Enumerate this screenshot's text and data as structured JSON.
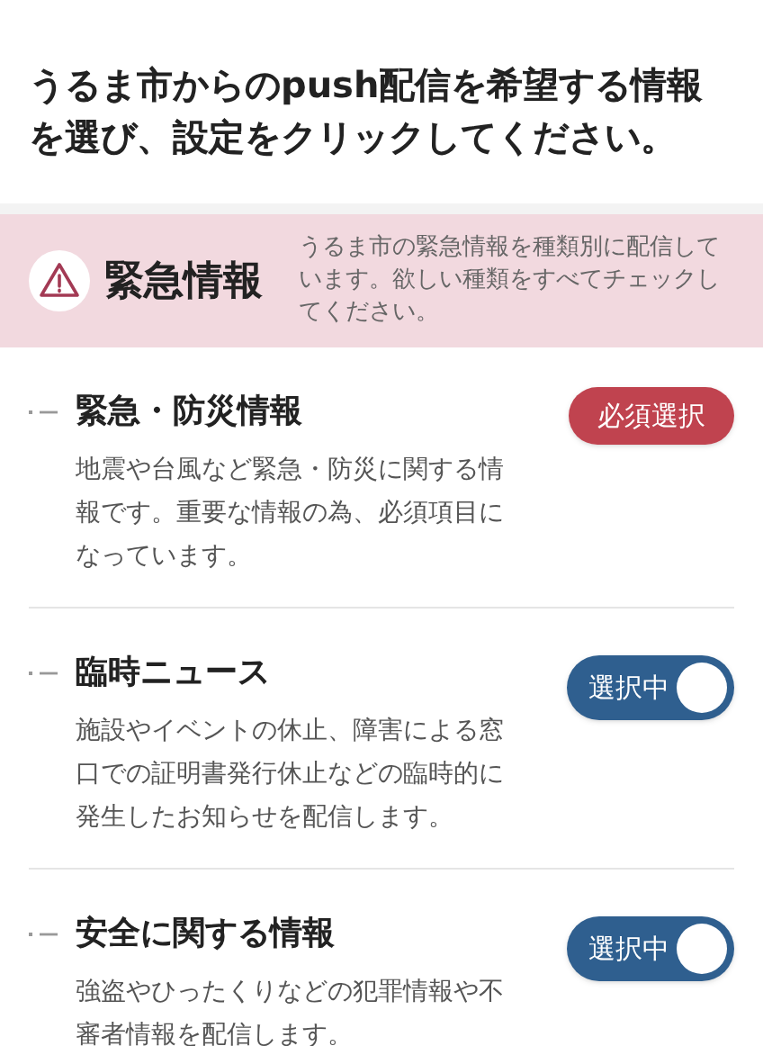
{
  "intro": "うるま市からのpush配信を希望する情報を選び、設定をクリックしてください。",
  "section": {
    "title": "緊急情報",
    "description": "うるま市の緊急情報を種類別に配信しています。欲しい種類をすべてチェックしてください。"
  },
  "items": [
    {
      "title": "緊急・防災情報",
      "description": "地震や台風など緊急・防災に関する情報です。重要な情報の為、必須項目になっています。",
      "kind": "required",
      "label": "必須選択"
    },
    {
      "title": "臨時ニュース",
      "description": "施設やイベントの休止、障害による窓口での証明書発行休止などの臨時的に発生したお知らせを配信します。",
      "kind": "toggle",
      "label": "選択中",
      "on": true
    },
    {
      "title": "安全に関する情報",
      "description": "強盗やひったくりなどの犯罪情報や不審者情報を配信します。",
      "kind": "toggle",
      "label": "選択中",
      "on": true
    }
  ]
}
